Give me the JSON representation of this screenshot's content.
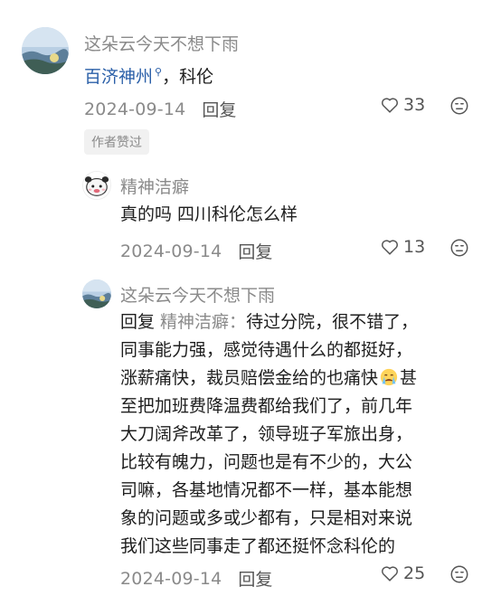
{
  "comment": {
    "author": "这朵云今天不想下雨",
    "link_text": "百济神州",
    "link_icon": "search-icon",
    "text_after": "，科伦",
    "date": "2024-09-14",
    "reply_label": "回复",
    "likes": "33",
    "badge": "作者赞过"
  },
  "replies": [
    {
      "author": "精神洁癖",
      "text": "真的吗 四川科伦怎么样",
      "date": "2024-09-14",
      "reply_label": "回复",
      "likes": "13"
    },
    {
      "author": "这朵云今天不想下雨",
      "reply_prefix": "回复 ",
      "reply_target": "精神洁癖：",
      "lines": [
        "待过分院，很不错了，",
        "同事能力强，感觉待遇什么的都挺好，",
        "涨薪痛快，裁员赔偿金给的也痛快",
        "甚",
        "至把加班费降温费都给我们了，前几年",
        "大刀阔斧改革了，领导班子军旅出身，",
        "比较有魄力，问题也是有不少的，大公",
        "司嘛，各基地情况都不一样，基本能想",
        "象的问题或多或少都有，只是相对来说",
        "我们这些同事走了都还挺怀念科伦的"
      ],
      "emoji": "crying-face-icon",
      "date": "2024-09-14",
      "reply_label": "回复",
      "likes": "25"
    }
  ],
  "colors": {
    "link": "#2a5fa8",
    "meta": "#8a8a8a",
    "text": "#1e1e1e"
  }
}
